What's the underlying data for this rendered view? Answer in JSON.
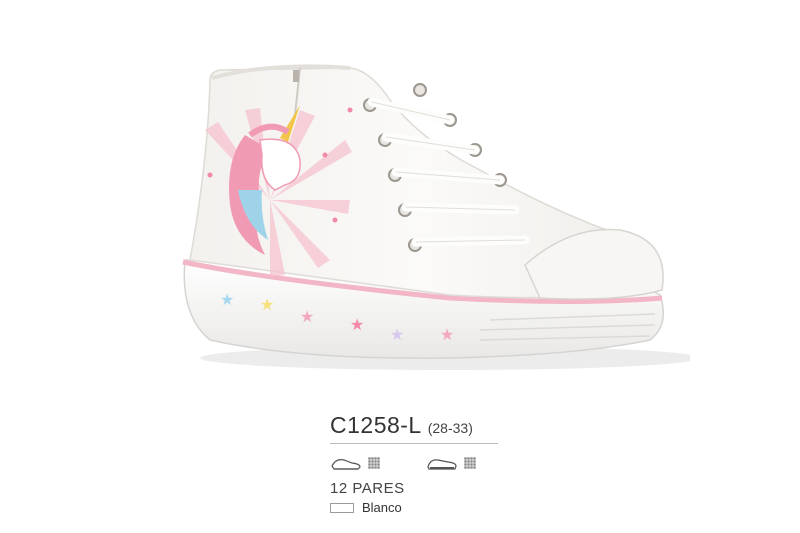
{
  "product": {
    "code": "C1258-L",
    "sizes": "(28-33)",
    "pairs": "12 PARES",
    "color_name": "Blanco",
    "color_swatch": "#ffffff",
    "accent_pink": "#f2b6c6"
  },
  "icons": {
    "sole_side": "shoe-sole-side-icon",
    "sole_top": "shoe-sole-top-icon",
    "material": "textile-texture-icon"
  }
}
